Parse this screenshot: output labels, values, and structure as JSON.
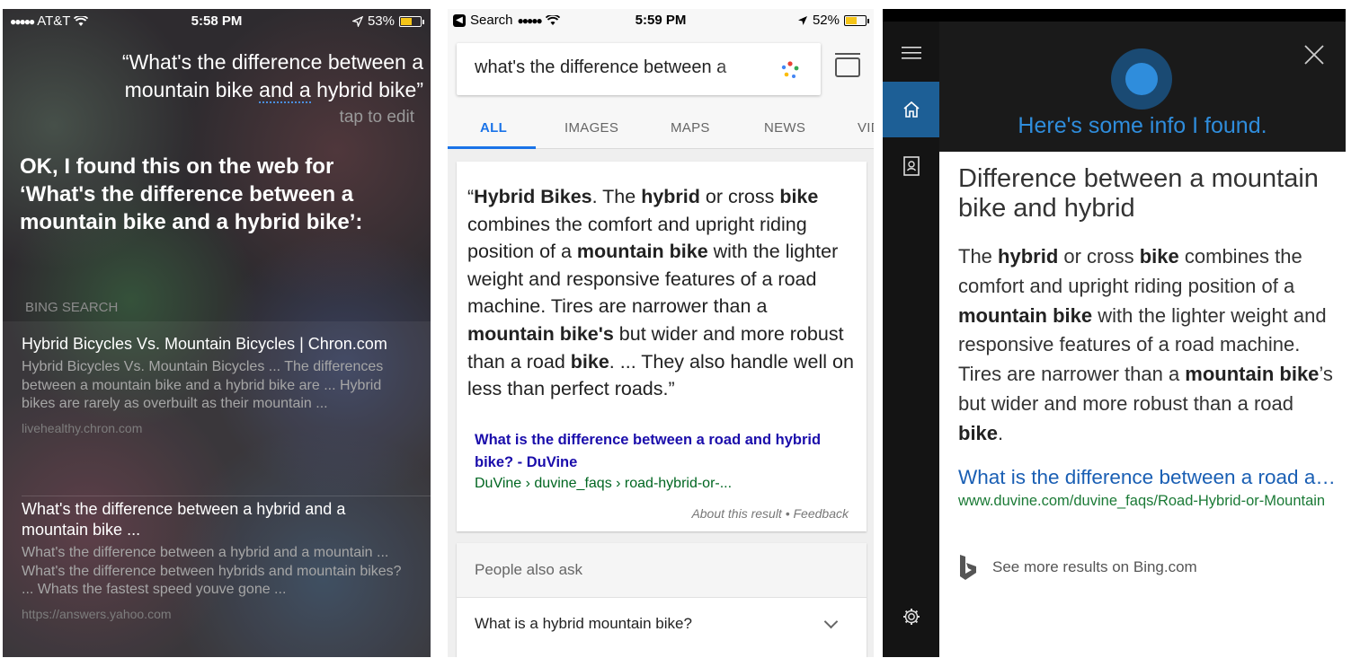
{
  "siri": {
    "status": {
      "carrier": "AT&T",
      "time": "5:58 PM",
      "battery": "53%",
      "battery_level": 0.53
    },
    "query_line1": "“What's the difference between a",
    "query_pre": "mountain bike ",
    "query_underlined": "and a",
    "query_post": " hybrid bike”",
    "edit_hint": "tap to edit",
    "answer": "OK, I found this on the web for ‘What's the difference between a mountain bike and a hybrid bike’:",
    "section_label": "BING SEARCH",
    "results": [
      {
        "title": "Hybrid Bicycles Vs. Mountain Bicycles | Chron.com",
        "snippet": "Hybrid Bicycles Vs. Mountain Bicycles ... The differences between a mountain bike and a hybrid bike are ... Hybrid bikes are rarely as overbuilt as their mountain ...",
        "url": "livehealthy.chron.com"
      },
      {
        "title": "What's the difference between a hybrid and a mountain bike ...",
        "snippet": "What's the difference between a hybrid and a mountain ... What's the difference between hybrids and mountain bikes? ... Whats the fastest speed youve gone ...",
        "url": "https://answers.yahoo.com"
      }
    ]
  },
  "google": {
    "status": {
      "back": "Search",
      "time": "5:59 PM",
      "battery": "52%",
      "battery_level": 0.52
    },
    "search_value": "what's the difference between a",
    "tabs": [
      "ALL",
      "IMAGES",
      "MAPS",
      "NEWS",
      "VIDEOS"
    ],
    "snippet": [
      {
        "text": "“",
        "bold": false
      },
      {
        "text": "Hybrid Bikes",
        "bold": true
      },
      {
        "text": ". The ",
        "bold": false
      },
      {
        "text": "hybrid",
        "bold": true
      },
      {
        "text": " or cross ",
        "bold": false
      },
      {
        "text": "bike",
        "bold": true
      },
      {
        "text": " combines the comfort and upright riding position of a ",
        "bold": false
      },
      {
        "text": "mountain bike",
        "bold": true
      },
      {
        "text": " with the lighter weight and responsive features of a road machine. Tires are narrower than a ",
        "bold": false
      },
      {
        "text": "mountain bike's",
        "bold": true
      },
      {
        "text": " but wider and more robust than a road ",
        "bold": false
      },
      {
        "text": "bike",
        "bold": true
      },
      {
        "text": ". ... They also handle well on less than perfect roads.”",
        "bold": false
      }
    ],
    "link_title": "What is the difference between a road and hybrid bike? - DuVine",
    "breadcrumb": "DuVine › duvine_faqs › road-hybrid-or-...",
    "about": "About this result • Feedback",
    "paa_heading": "People also ask",
    "paa_question": "What is a hybrid mountain bike?"
  },
  "cortana": {
    "greeting": "Here's some info I found.",
    "title": "Difference between a mountain bike and hybrid",
    "text": [
      {
        "text": "The ",
        "bold": false
      },
      {
        "text": "hybrid",
        "bold": true
      },
      {
        "text": " or cross ",
        "bold": false
      },
      {
        "text": "bike",
        "bold": true
      },
      {
        "text": " combines the comfort and upright riding position of a ",
        "bold": false
      },
      {
        "text": "mountain bike",
        "bold": true
      },
      {
        "text": " with the lighter weight and responsive features of a road machine. Tires are narrower than a ",
        "bold": false
      },
      {
        "text": "mountain bike",
        "bold": true
      },
      {
        "text": "’s but wider and more robust than a road ",
        "bold": false
      },
      {
        "text": "bike",
        "bold": true
      },
      {
        "text": ".",
        "bold": false
      }
    ],
    "link": "What is the difference between a road and hybrid bike?",
    "url": "www.duvine.com/duvine_faqs/Road-Hybrid-or-Mountain",
    "bing_more": "See more results on Bing.com"
  },
  "colors": {
    "google_blue": "#1a73e8",
    "cortana_blue": "#2f8ddc",
    "link_green": "#006621",
    "rail_active": "#1d5f96"
  },
  "icons": [
    "wifi-icon",
    "location-arrow-icon",
    "battery-icon",
    "google-dots-icon",
    "tab-switcher-icon",
    "chevron-down-icon",
    "hamburger-icon",
    "home-icon",
    "notebook-icon",
    "settings-icon",
    "close-icon",
    "cortana-orb-icon",
    "bing-logo-icon"
  ]
}
